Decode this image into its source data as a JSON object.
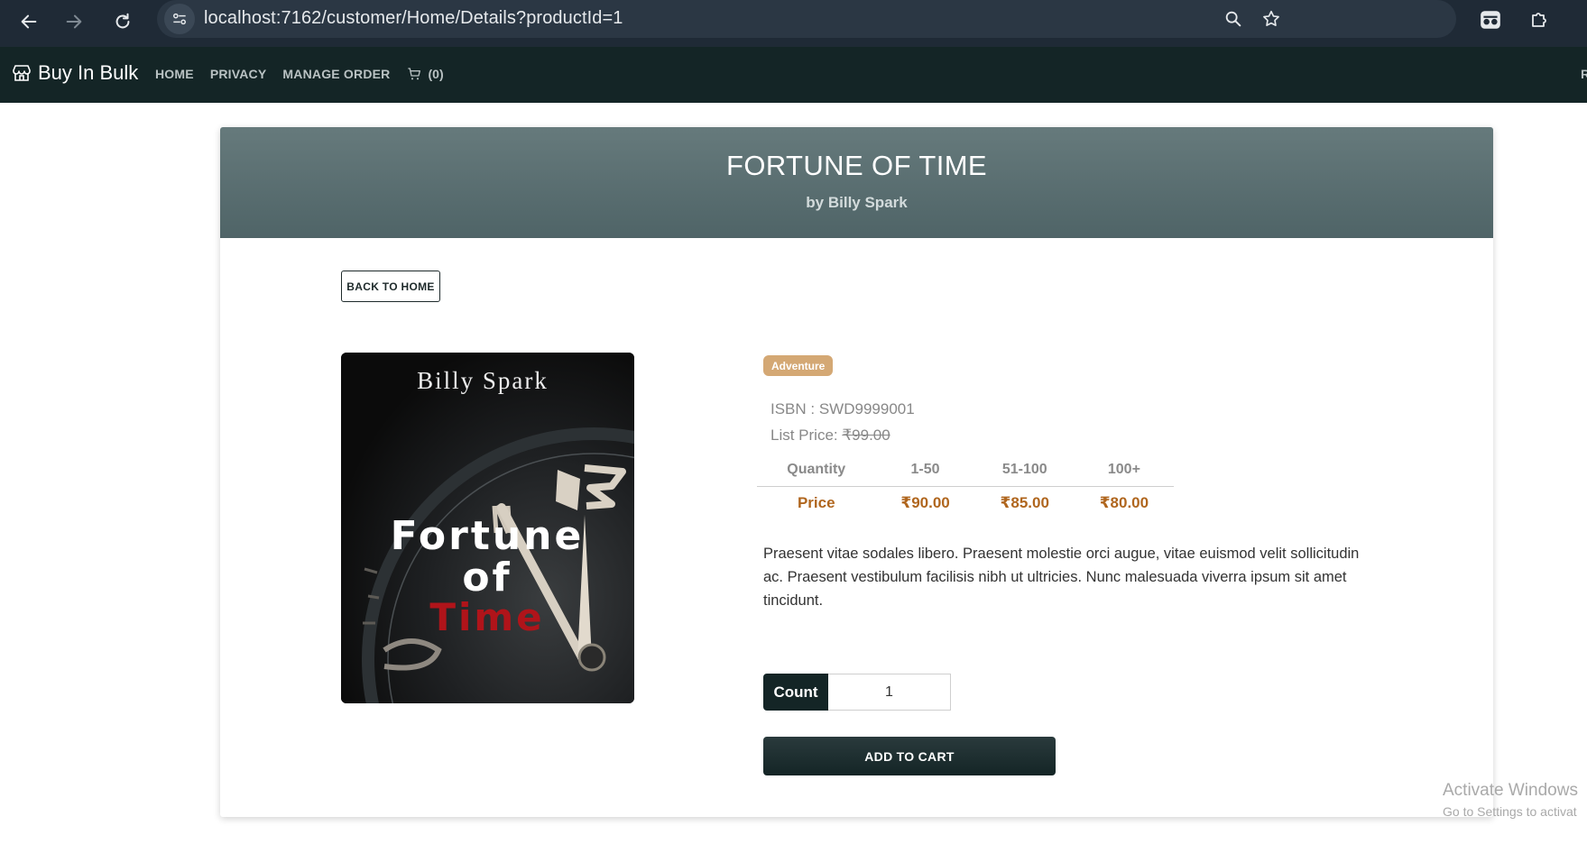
{
  "browser": {
    "url": "localhost:7162/customer/Home/Details?productId=1"
  },
  "navbar": {
    "brand": "Buy In Bulk",
    "items": [
      "HOME",
      "PRIVACY",
      "MANAGE ORDER"
    ],
    "cart_count": "(0)",
    "edge_text": "R"
  },
  "product": {
    "title": "FORTUNE OF TIME",
    "author": "by Billy Spark",
    "back_label": "BACK TO HOME",
    "category": "Adventure",
    "isbn_label": "ISBN : SWD9999001",
    "list_price_label": "List Price: ",
    "list_price_value": "₹99.00",
    "description": "Praesent vitae sodales libero. Praesent molestie orci augue, vitae euismod velit sollicitudin ac. Praesent vestibulum facilisis nibh ut ultricies. Nunc malesuada viverra ipsum sit amet tincidunt.",
    "price_table": {
      "header": [
        "Quantity",
        "1-50",
        "51-100",
        "100+"
      ],
      "row": [
        "Price",
        "₹90.00",
        "₹85.00",
        "₹80.00"
      ]
    },
    "count_label": "Count",
    "count_value": "1",
    "add_to_cart_label": "ADD TO CART",
    "cover": {
      "author": "Billy Spark",
      "line1": "Fortune",
      "line2": "of",
      "line3": "Time",
      "accent_color": "#b0141a"
    }
  },
  "watermark": {
    "line1": "Activate Windows",
    "line2": "Go to Settings to activat"
  },
  "colors": {
    "chrome_bg": "#1f2a36",
    "navbar_bg": "#142526",
    "header_bg": "#5a6e70",
    "badge_bg": "#d4a874",
    "price_color": "#b0661e"
  }
}
